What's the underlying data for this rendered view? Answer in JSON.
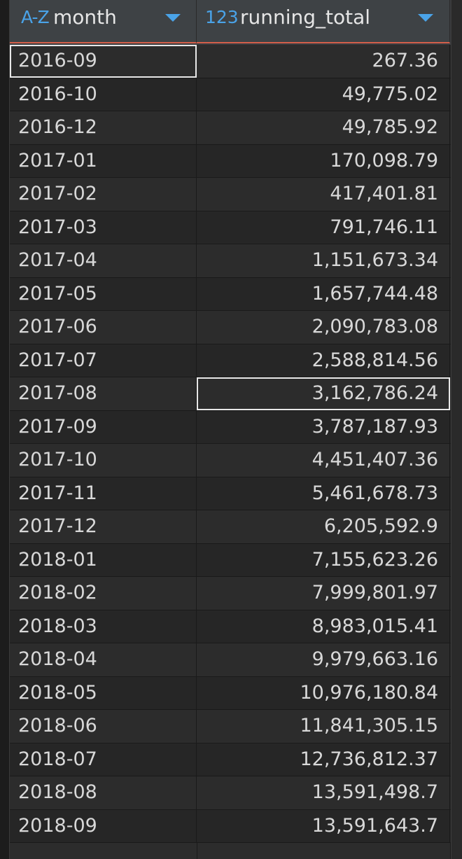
{
  "columns": [
    {
      "type_icon": "A-Z",
      "name": "month"
    },
    {
      "type_icon": "123",
      "name": "running_total"
    }
  ],
  "rows": [
    {
      "month": "2016-09",
      "running_total": "267.36"
    },
    {
      "month": "2016-10",
      "running_total": "49,775.02"
    },
    {
      "month": "2016-12",
      "running_total": "49,785.92"
    },
    {
      "month": "2017-01",
      "running_total": "170,098.79"
    },
    {
      "month": "2017-02",
      "running_total": "417,401.81"
    },
    {
      "month": "2017-03",
      "running_total": "791,746.11"
    },
    {
      "month": "2017-04",
      "running_total": "1,151,673.34"
    },
    {
      "month": "2017-05",
      "running_total": "1,657,744.48"
    },
    {
      "month": "2017-06",
      "running_total": "2,090,783.08"
    },
    {
      "month": "2017-07",
      "running_total": "2,588,814.56"
    },
    {
      "month": "2017-08",
      "running_total": "3,162,786.24"
    },
    {
      "month": "2017-09",
      "running_total": "3,787,187.93"
    },
    {
      "month": "2017-10",
      "running_total": "4,451,407.36"
    },
    {
      "month": "2017-11",
      "running_total": "5,461,678.73"
    },
    {
      "month": "2017-12",
      "running_total": "6,205,592.9"
    },
    {
      "month": "2018-01",
      "running_total": "7,155,623.26"
    },
    {
      "month": "2018-02",
      "running_total": "7,999,801.97"
    },
    {
      "month": "2018-03",
      "running_total": "8,983,015.41"
    },
    {
      "month": "2018-04",
      "running_total": "9,979,663.16"
    },
    {
      "month": "2018-05",
      "running_total": "10,976,180.84"
    },
    {
      "month": "2018-06",
      "running_total": "11,841,305.15"
    },
    {
      "month": "2018-07",
      "running_total": "12,736,812.37"
    },
    {
      "month": "2018-08",
      "running_total": "13,591,498.7"
    },
    {
      "month": "2018-09",
      "running_total": "13,591,643.7"
    }
  ],
  "selection": {
    "active_row": 0,
    "active_column": "month",
    "focused_row": 10,
    "focused_column": "running_total"
  },
  "colors": {
    "header_underline": "#d35f4a",
    "type_icon": "#4aa3e8",
    "text": "#d8d8d8"
  }
}
